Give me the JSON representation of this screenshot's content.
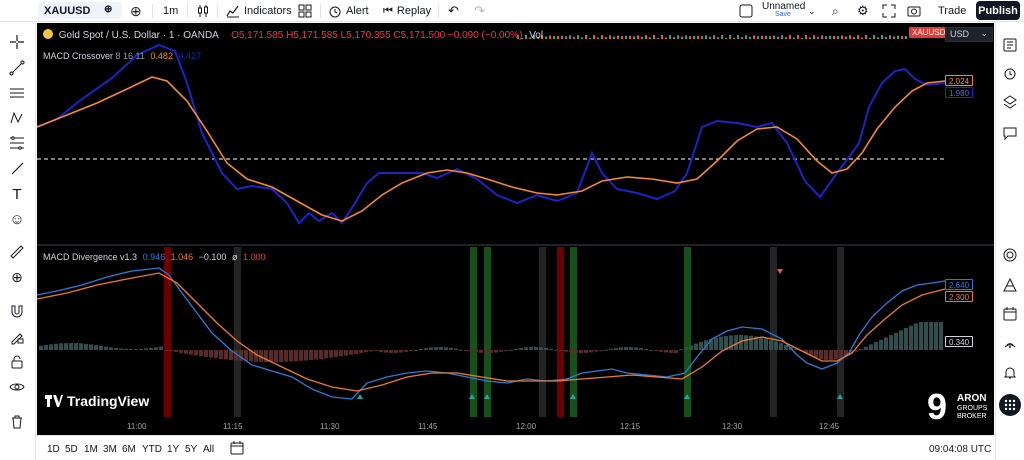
{
  "header": {
    "symbol": "XAUUSD",
    "interval": "1m",
    "indicators_label": "Indicators",
    "alert_label": "Alert",
    "replay_label": "Replay",
    "layout_name": "Unnamed",
    "layout_sub": "Save",
    "trade_label": "Trade",
    "publish_label": "Publish"
  },
  "chart": {
    "title": "Gold Spot / U.S. Dollar · 1 · OANDA",
    "ohlc": "O5,171.585 H5,171.585 L5,170.355 C5,171.500 −0.090 (−0.00%)",
    "vol_label": "Vol",
    "symbol_badge": "XAUUSD",
    "currency": "USD",
    "pane1": {
      "name": "MACD Crossover",
      "params": "8 16 11",
      "v1": "0.482",
      "v2": "0.427",
      "tag1": "2.024",
      "tag2": "1.980"
    },
    "pane2": {
      "name": "MACD Divergence v1.3",
      "v1": "0.946",
      "v2": "1.046",
      "v3": "−0.100",
      "v4": "ø",
      "v5": "1.000",
      "tag1": "2.640",
      "tag2": "2.300",
      "tag3": "0.340"
    },
    "time_labels": [
      "11:00",
      "11:15",
      "11:30",
      "11:45",
      "12:00",
      "12:15",
      "12:30",
      "12:45"
    ],
    "watermark": "TradingView",
    "broker_line1": "ARON",
    "broker_line2": "GROUPS",
    "broker_line3": "BROKER"
  },
  "footer": {
    "ranges": [
      "1D",
      "5D",
      "1M",
      "3M",
      "6M",
      "YTD",
      "1Y",
      "5Y",
      "All"
    ],
    "clock": "09:04:08 UTC"
  },
  "colors": {
    "macd_line": "#1e22c8",
    "signal_line": "#f58a2f",
    "pane2_macd": "#2a7bd8",
    "pane2_signal": "#f07a2a",
    "hist_pos": "#2f4f4f",
    "hist_neg": "#5a2a2a",
    "bull_bar": "#1b5e20",
    "bear_bar": "#7f0000",
    "badge_red": "#e53935"
  }
}
